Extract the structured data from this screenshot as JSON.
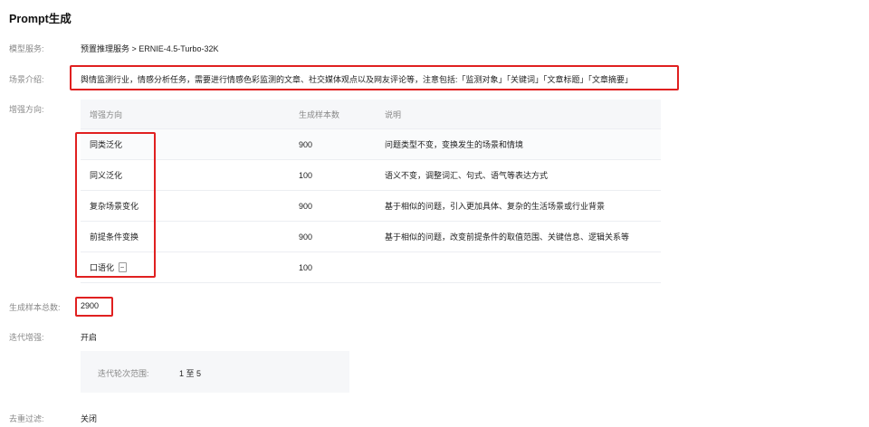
{
  "title": "Prompt生成",
  "fields": {
    "model_label": "模型服务:",
    "model_value": "预置推理服务 > ERNIE-4.5-Turbo-32K",
    "scene_label": "场景介绍:",
    "scene_value": "舆情监测行业，情感分析任务，需要进行情感色彩监测的文章、社交媒体观点以及网友评论等，注意包括:「监测对象」「关键词」「文章标题」「文章摘要」",
    "enhance_label": "增强方向:",
    "total_label": "生成样本总数:",
    "total_value": "2900",
    "iter_label": "迭代增强:",
    "iter_value": "开启",
    "iter_range_label": "迭代轮次范围:",
    "iter_range_value": "1 至 5",
    "dedup_label": "去重过滤:",
    "dedup_value": "关闭"
  },
  "table": {
    "headers": [
      "增强方向",
      "生成样本数",
      "说明"
    ],
    "rows": [
      {
        "dir": "同类泛化",
        "count": "900",
        "desc": "问题类型不变，变换发生的场景和情境"
      },
      {
        "dir": "同义泛化",
        "count": "100",
        "desc": "语义不变，调整词汇、句式、语气等表达方式"
      },
      {
        "dir": "复杂场景变化",
        "count": "900",
        "desc": "基于相似的问题，引入更加具体、复杂的生活场景或行业背景"
      },
      {
        "dir": "前提条件变换",
        "count": "900",
        "desc": "基于相似的问题，改变前提条件的取值范围、关键信息、逻辑关系等"
      },
      {
        "dir": "口语化",
        "count": "100",
        "desc": "",
        "icon": "document-icon"
      }
    ]
  },
  "colors": {
    "highlight": "#e02020"
  }
}
